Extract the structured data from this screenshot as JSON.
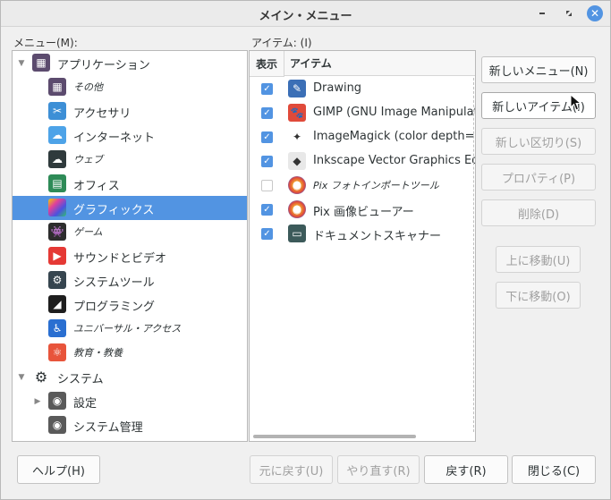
{
  "window": {
    "title": "メイン・メニュー"
  },
  "menu_label": "メニュー(M):",
  "items_label": "アイテム: (I)",
  "menu_tree": [
    {
      "label": "アプリケーション",
      "icon": "apps-grid-icon",
      "color": "#5c4b6e",
      "expanded": true
    },
    {
      "label": "その他",
      "icon": "grid-icon",
      "color": "#5c4b6e",
      "italic": true
    },
    {
      "label": "アクセサリ",
      "icon": "scissors-icon",
      "color": "#3d8fd6"
    },
    {
      "label": "インターネット",
      "icon": "cloud-icon",
      "color": "#4da3e8"
    },
    {
      "label": "ウェブ",
      "icon": "cloud-outline-icon",
      "color": "#2f3a3c",
      "italic": true
    },
    {
      "label": "オフィス",
      "icon": "office-icon",
      "color": "#2e8b57"
    },
    {
      "label": "グラフィックス",
      "icon": "gradient-icon",
      "color": "#e0409a",
      "selected": true
    },
    {
      "label": "ゲーム",
      "icon": "invader-icon",
      "color": "#2d2d2d",
      "italic": true
    },
    {
      "label": "サウンドとビデオ",
      "icon": "play-icon",
      "color": "#e53935"
    },
    {
      "label": "システムツール",
      "icon": "gear-icon",
      "color": "#36454f"
    },
    {
      "label": "プログラミング",
      "icon": "triangle-ruler-icon",
      "color": "#1e1e1e"
    },
    {
      "label": "ユニバーサル・アクセス",
      "icon": "accessibility-icon",
      "color": "#2a6fd1",
      "italic": true
    },
    {
      "label": "教育・教養",
      "icon": "atom-icon",
      "color": "#e8543b",
      "italic": true
    },
    {
      "label": "システム",
      "icon": "gear-icon",
      "color": "#2e3436",
      "expanded": true
    },
    {
      "label": "設定",
      "icon": "toggle-green-icon",
      "color": "#5a5a5a",
      "collapsed": true
    },
    {
      "label": "システム管理",
      "icon": "toggle-gray-icon",
      "color": "#5a5a5a"
    }
  ],
  "columns": {
    "show": "表示",
    "item": "アイテム"
  },
  "items": [
    {
      "checked": true,
      "label": "Drawing",
      "icon": "drawing-icon",
      "color": "#3b6fb6"
    },
    {
      "checked": true,
      "label": "GIMP (GNU Image Manipulat",
      "icon": "gimp-icon",
      "color": "#e04a3a"
    },
    {
      "checked": true,
      "label": "ImageMagick (color depth=q",
      "icon": "imagemagick-icon",
      "color": "#ffffff"
    },
    {
      "checked": true,
      "label": "Inkscape Vector Graphics Edi",
      "icon": "inkscape-icon",
      "color": "#e8e8e8"
    },
    {
      "checked": false,
      "label": "Pix フォトインポートツール",
      "icon": "pix-icon",
      "color": "#f0a030",
      "italic": true
    },
    {
      "checked": true,
      "label": "Pix 画像ビューアー",
      "icon": "pix-icon",
      "color": "#f0a030"
    },
    {
      "checked": true,
      "label": "ドキュメントスキャナー",
      "icon": "scanner-icon",
      "color": "#3c5a5a"
    }
  ],
  "buttons": {
    "new_menu": "新しいメニュー(N)",
    "new_item": "新しいアイテム(I)",
    "new_separator": "新しい区切り(S)",
    "properties": "プロパティ(P)",
    "delete": "削除(D)",
    "move_up": "上に移動(U)",
    "move_down": "下に移動(O)",
    "help": "ヘルプ(H)",
    "undo": "元に戻す(U)",
    "redo": "やり直す(R)",
    "revert": "戻す(R)",
    "close": "閉じる(C)"
  },
  "accent": "#5294e2"
}
